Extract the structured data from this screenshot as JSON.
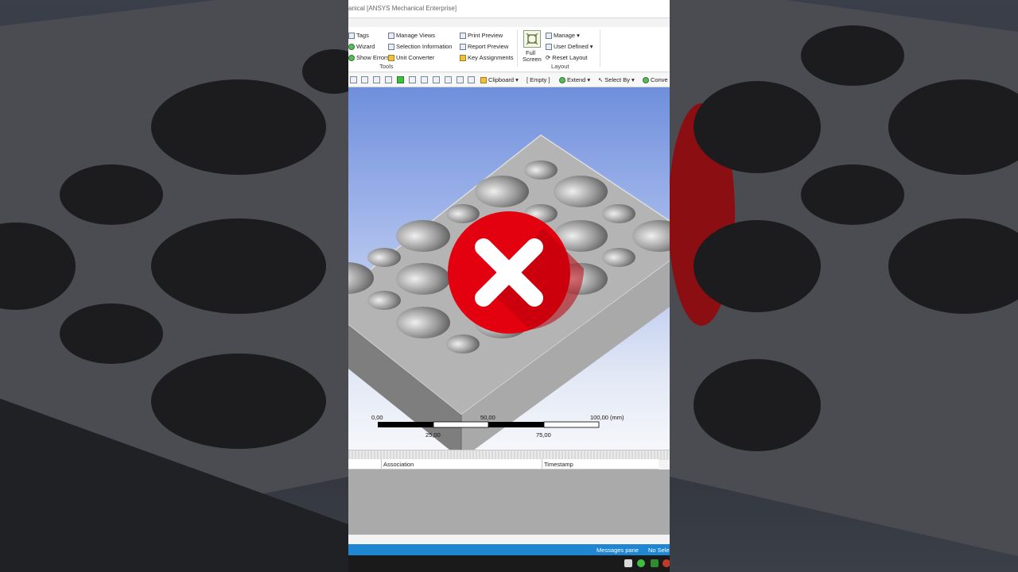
{
  "window": {
    "title": "anical [ANSYS Mechanical Enterprise]"
  },
  "ribbon": {
    "tools": {
      "label": "Tools",
      "items": [
        "Tags",
        "Wizard",
        "Show Errors",
        "Manage Views",
        "Selection Information",
        "Unit Converter",
        "Print Preview",
        "Report Preview",
        "Key Assignments"
      ]
    },
    "layout": {
      "label": "Layout",
      "full_screen": [
        "Full",
        "Screen"
      ],
      "items": [
        "Manage",
        "User Defined",
        "Reset Layout"
      ]
    }
  },
  "toolbar": {
    "clipboard": "Clipboard",
    "empty": "[ Empty ]",
    "extend": "Extend",
    "select_by": "Select By",
    "convert": "Conve"
  },
  "viewport": {
    "error_icon": "close-icon",
    "accent": "#e3000f",
    "scale_bar": {
      "top_labels": [
        "0,00",
        "50,00",
        "100,00 (mm)"
      ],
      "bottom_labels": [
        "25,00",
        "75,00"
      ]
    }
  },
  "messages": {
    "columns": [
      "Association",
      "Timestamp"
    ]
  },
  "status": {
    "messages_pane": "Messages pane",
    "selection": "No Sele"
  }
}
